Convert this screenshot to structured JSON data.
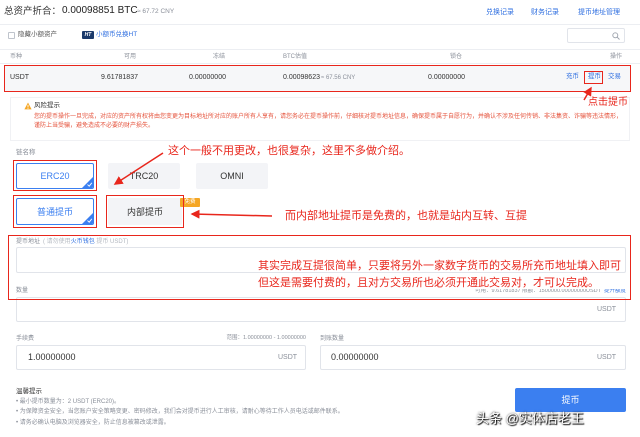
{
  "header": {
    "total_label": "总资产折合：",
    "total_btc": "0.00098851 BTC",
    "total_cny": "≈ 67.72 CNY",
    "links": [
      "兑换记录",
      "财务记录",
      "提币地址管理"
    ]
  },
  "filters": {
    "hide_small_label": "隐藏小额资产",
    "ht_badge": "HT",
    "convert_link": "小额币兑换HT"
  },
  "table": {
    "columns": [
      "币种",
      "可用",
      "冻结",
      "BTC估值",
      "锁仓",
      "操作"
    ],
    "row": {
      "coin": "USDT",
      "available": "9.61781837",
      "frozen": "0.00000000",
      "btc_value": "0.00098623",
      "btc_value_cny": "≈ 67.56 CNY",
      "locked": "0.00000000",
      "actions": [
        "充币",
        "提币",
        "交易"
      ]
    }
  },
  "risk": {
    "title": "风险提示",
    "text": "您的提币操作一旦完成，对应的资产所有权将由您变更为目标地址所对应的账户所有人享有，请您务必在提币操作前，仔细核对提币地址信息，确保提币属于自愿行为，并确认不涉及任何传销、非法集资、诈骗等违法情形，谨防上当受骗，避免造成不必要的财产损失。"
  },
  "chain": {
    "label": "链名称",
    "options": [
      {
        "label": "ERC20",
        "selected": true
      },
      {
        "label": "TRC20",
        "selected": false
      },
      {
        "label": "OMNI",
        "selected": false
      }
    ]
  },
  "withdraw_type": {
    "options": [
      {
        "label": "普通提币",
        "selected": true
      },
      {
        "label": "内部提币",
        "selected": false
      }
    ],
    "free_badge": "免费"
  },
  "address": {
    "label": "提币地址",
    "hint_prefix": "( 请勿使用 ",
    "hint_link": "火币钱包",
    "hint_suffix": " 提币 USDT)"
  },
  "amount": {
    "label": "数量",
    "limit_text": "可用：9.61781837 限额：1500000.00000000USDT",
    "limit_link": "提升额度",
    "unit": "USDT"
  },
  "fee": {
    "label": "手续费",
    "range": "范围：1.00000000 - 1.00000000",
    "value": "1.00000000",
    "unit": "USDT"
  },
  "receive": {
    "label": "到账数量",
    "value": "0.00000000",
    "unit": "USDT"
  },
  "tips": {
    "title": "温馨提示",
    "items": [
      "最小提币数量为：2 USDT (ERC20)。",
      "为保障资金安全，当您账户安全策略变更、密码修改，我们会对提币进行人工审核，请耐心等待工作人员电话或邮件联系。",
      "请务必确认电脑及浏览器安全，防止信息被篡改或泄露。"
    ]
  },
  "submit_label": "提币",
  "annotations": {
    "click_withdraw": "点击提币",
    "chain_note": "这个一般不用更改，也很复杂，这里不多做介绍。",
    "internal_note": "而内部地址提币是免费的，也就是站内互转、互提",
    "external_note_1": "其实完成互提很简单，只要将另外一家数字货币的交易所充币地址填入即可",
    "external_note_2": "但这是需要付费的，且对方交易所也必须开通此交易对，才可以完成。"
  },
  "watermark": {
    "brand": "头条",
    "handle": "@实体店老王"
  },
  "icons": {
    "search": "search-icon",
    "warning": "warning-icon",
    "check": "check-icon",
    "ht_logo": "ht-logo-icon"
  },
  "colors": {
    "primary": "#3b7ff0",
    "link": "#2f6fe0",
    "annotation": "#e8261c",
    "risk_text": "#e5533c",
    "badge": "#f5a623"
  }
}
